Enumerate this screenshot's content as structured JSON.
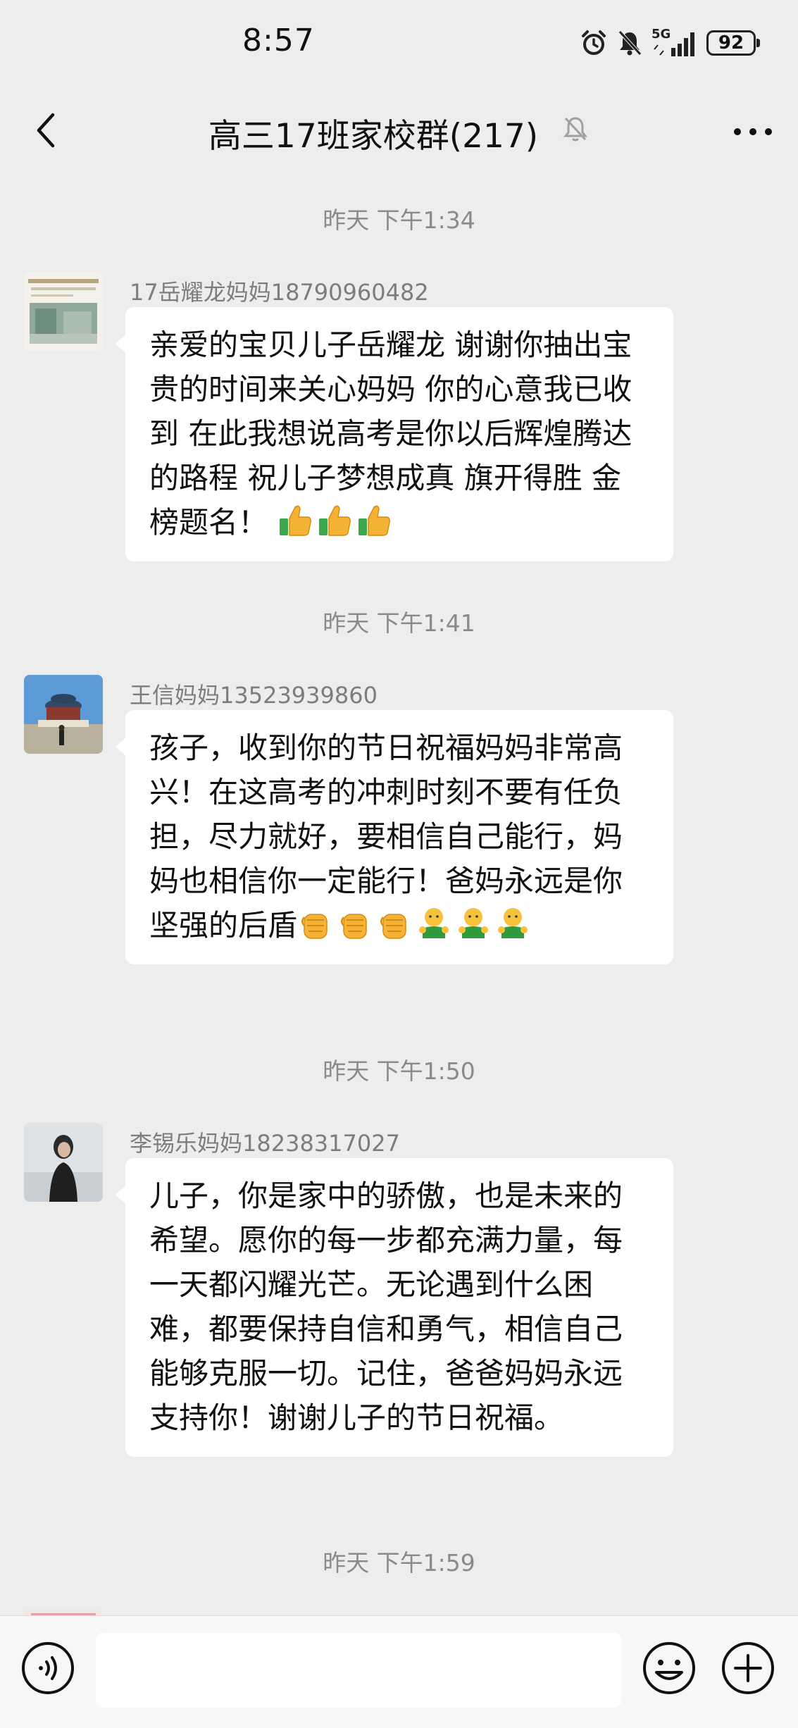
{
  "status_bar": {
    "time": "8:57",
    "network": "5G",
    "battery": "92"
  },
  "header": {
    "title": "高三17班家校群(217)"
  },
  "messages": [
    {
      "timestamp": "昨天 下午1:34",
      "sender": "17岳耀龙妈妈18790960482",
      "text": "亲爱的宝贝儿子岳耀龙 谢谢你抽出宝贵的时间来关心妈妈 你的心意我已收到 在此我想说高考是你以后辉煌腾达的路程 祝儿子梦想成真 旗开得胜 金榜题名！ ",
      "emojis": [
        "thumbs-up-emoji",
        "thumbs-up-emoji",
        "thumbs-up-emoji"
      ]
    },
    {
      "timestamp": "昨天 下午1:41",
      "sender": "王信妈妈13523939860",
      "text": "孩子，收到你的节日祝福妈妈非常高兴！在这高考的冲刺时刻不要有任负担，尽力就好，要相信自己能行，妈妈也相信你一定能行！爸妈永远是你坚强的后盾",
      "emojis": [
        "fist-emoji",
        "fist-emoji",
        "fist-emoji",
        "hug-emoji",
        "hug-emoji",
        "hug-emoji"
      ]
    },
    {
      "timestamp": "昨天 下午1:50",
      "sender": "李锡乐妈妈18238317027",
      "text": "儿子，你是家中的骄傲，也是未来的希望。愿你的每一步都充满力量，每一天都闪耀光芒。无论遇到什么困难，都要保持自信和勇气，相信自己能够克服一切。记住，爸爸妈妈永远支持你！谢谢儿子的节日祝福。",
      "emojis": []
    },
    {
      "timestamp": "昨天 下午1:59"
    }
  ],
  "input_bar": {
    "input_value": "",
    "icons": [
      "voice-icon",
      "emoji-face-icon",
      "plus-icon"
    ]
  }
}
